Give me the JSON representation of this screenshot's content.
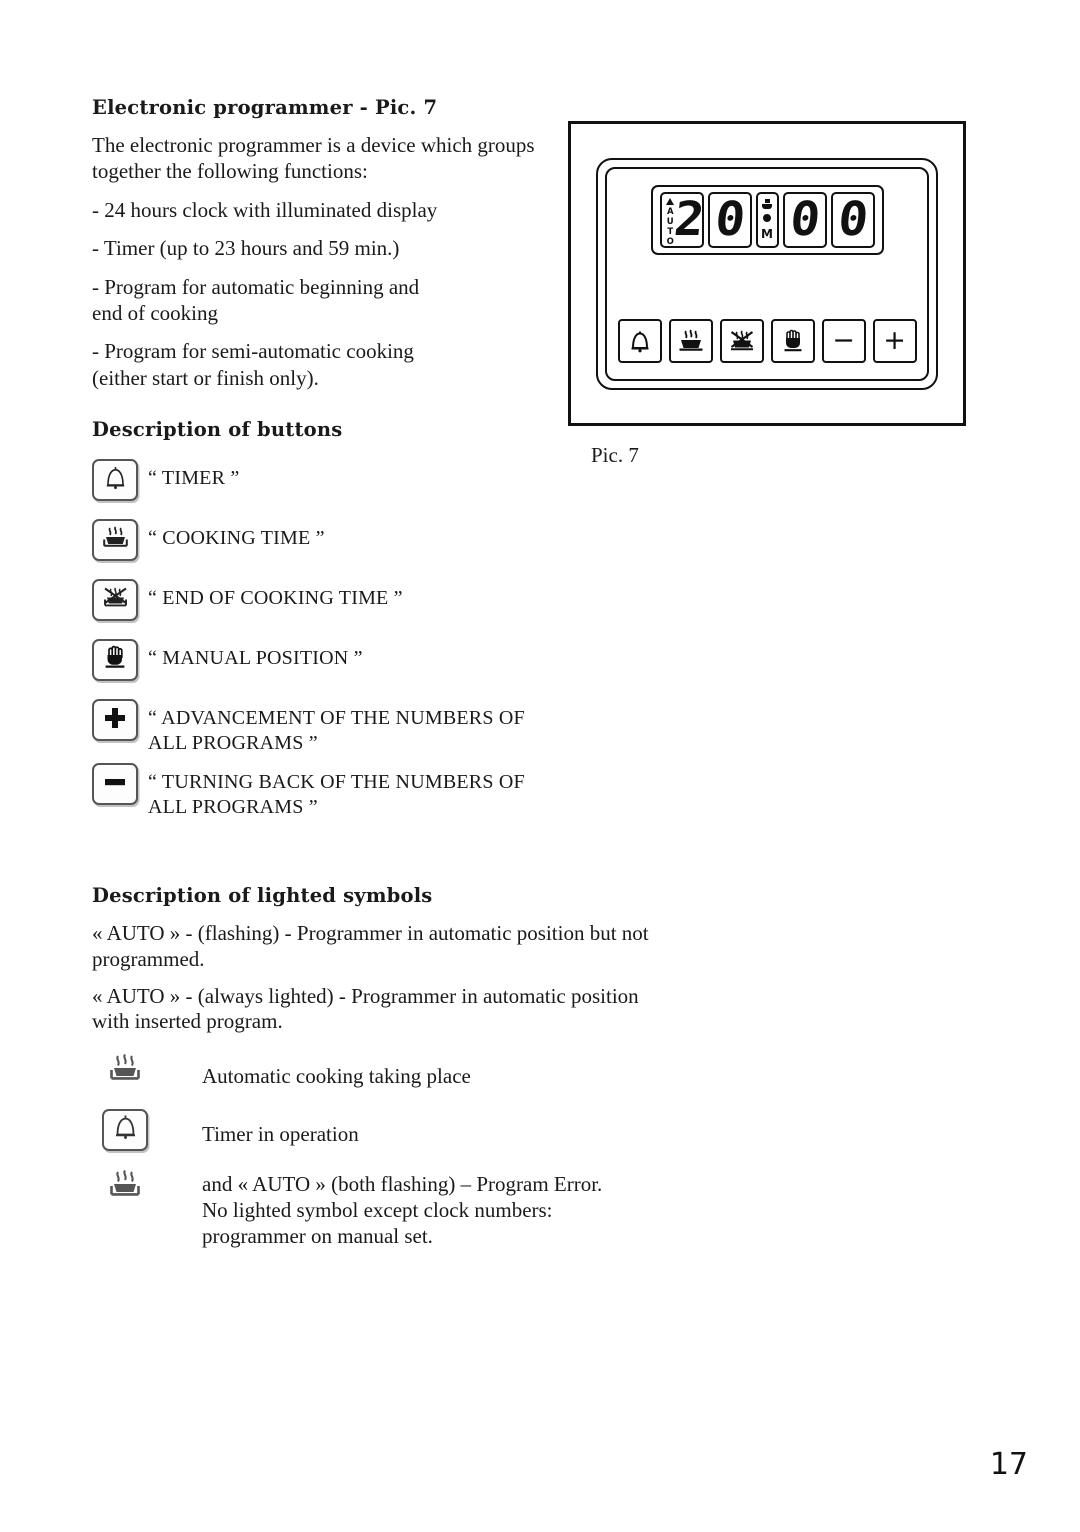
{
  "document": {
    "page_number": "17"
  },
  "intro": {
    "heading": "Electronic programmer - Pic. 7",
    "paragraph": "The electronic programmer is a device which groups together the following functions:",
    "functions": [
      "- 24 hours clock with illuminated display",
      "- Timer (up to 23 hours and 59 min.)",
      "- Program for automatic beginning and\n   end of cooking",
      "- Program for semi-automatic cooking\n   (either start or finish only)."
    ]
  },
  "figure": {
    "caption": "Pic. 7",
    "display": {
      "auto_indicator": "AUTO",
      "digits": [
        "2",
        "0",
        "0",
        "0"
      ],
      "separator_letter": "M",
      "time_value": "20:00"
    },
    "panel_buttons": [
      {
        "name": "timer-bell",
        "glyph": "bell"
      },
      {
        "name": "cooking-time",
        "glyph": "pot"
      },
      {
        "name": "end-of-cooking-time",
        "glyph": "pot-crossed"
      },
      {
        "name": "manual-position",
        "glyph": "hand"
      },
      {
        "name": "decrease",
        "glyph": "−"
      },
      {
        "name": "increase",
        "glyph": "+"
      }
    ]
  },
  "buttons_section": {
    "heading": "Description of buttons",
    "rows": [
      {
        "icon": "bell",
        "label": "“ TIMER ”"
      },
      {
        "icon": "pot",
        "label": "“ COOKING TIME  ”"
      },
      {
        "icon": "pot-crossed",
        "label": "“ END OF COOKING TIME  ”"
      },
      {
        "icon": "hand",
        "label": "“ MANUAL POSITION ”"
      },
      {
        "icon": "plus",
        "label": "“ ADVANCEMENT OF THE NUMBERS OF\nALL PROGRAMS ”"
      },
      {
        "icon": "minus",
        "label": "“ TURNING BACK OF THE NUMBERS OF\nALL PROGRAMS ”"
      }
    ]
  },
  "lighted_section": {
    "heading": "Description of lighted symbols",
    "paragraphs": [
      "« AUTO » - (flashing) - Programmer in automatic position but not programmed.",
      "« AUTO » - (always lighted) - Programmer in automatic position with inserted program."
    ],
    "rows": [
      {
        "icon": "pot",
        "label": "Automatic cooking taking place"
      },
      {
        "icon": "bell",
        "label": "Timer in operation"
      },
      {
        "icon": "pot",
        "label": "and  « AUTO » (both flashing) – Program Error.\nNo lighted symbol except clock numbers:\nprogrammer on manual set."
      }
    ]
  }
}
